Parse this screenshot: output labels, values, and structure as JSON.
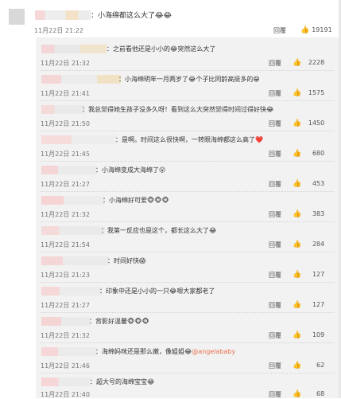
{
  "top_comment": {
    "text": "：小海绵都这么大了😂😂",
    "time": "11月22日 21:22",
    "reply_label": "回覆",
    "like_count": "19191"
  },
  "replies": [
    {
      "text": "：之前看他还是小小的😂突然这么大了",
      "time": "11月22日 21:32",
      "reply_label": "回覆",
      "like_count": "2228"
    },
    {
      "text": "：小海绵明年一月两岁了😂个子比同龄高挺多的😁",
      "time": "11月22日 21:41",
      "reply_label": "回覆",
      "like_count": "1575"
    },
    {
      "text": "：我总觉得她生孩子没多久呀！看到这么大突然觉得时间过得好快😂",
      "time": "11月22日 21:50",
      "reply_label": "回覆",
      "like_count": "1450"
    },
    {
      "text": "：是啊。时间这么很快啊，一转眼海绵都这么高了❤️",
      "time": "11月22日 21:45",
      "reply_label": "回覆",
      "like_count": "680"
    },
    {
      "text": "：小海绵变成大海绵了😮",
      "time": "11月22日 21:27",
      "reply_label": "回覆",
      "like_count": "453"
    },
    {
      "text": "：小海绵好可爱🐵🐵🐵",
      "time": "11月22日 21:32",
      "reply_label": "回覆",
      "like_count": "383"
    },
    {
      "text": "：我第一反应也是这个，都长这么大了😂",
      "time": "11月22日 21:54",
      "reply_label": "回覆",
      "like_count": "284"
    },
    {
      "text": "：时间好快😱",
      "time": "11月22日 21:23",
      "reply_label": "回覆",
      "like_count": "127"
    },
    {
      "text": "：印象中还是小小的一只😂嗯大家都老了",
      "time": "11月22日 21:27",
      "reply_label": "回覆",
      "like_count": "127"
    },
    {
      "text": "：背影好温馨🐵🐵🐵",
      "time": "11月22日 21:32",
      "reply_label": "回覆",
      "like_count": "109"
    },
    {
      "text": "：海绵妈咪还是那么嫩，像姐姐😂",
      "mention": "@angelababy",
      "time": "11月22日 21:46",
      "reply_label": "回覆",
      "like_count": "62"
    },
    {
      "text": "：超大号的海绵宝宝😂",
      "time": "11月22日 21:40",
      "reply_label": "回覆",
      "like_count": "68"
    }
  ],
  "icons": {
    "like": "thumbs-up-icon"
  },
  "colors": {
    "panel_bg": "#f2f2f2",
    "mention": "#eb7350"
  }
}
